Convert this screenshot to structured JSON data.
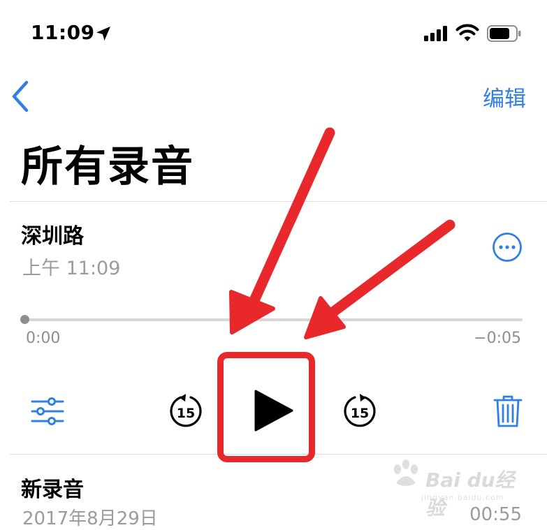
{
  "status_bar": {
    "time": "11:09",
    "icons": [
      "location-arrow-icon",
      "cellular-signal-icon",
      "wifi-icon",
      "battery-icon"
    ]
  },
  "nav": {
    "back_icon": "chevron-left-icon",
    "edit_label": "编辑"
  },
  "page_title": "所有录音",
  "recordings": [
    {
      "title": "深圳路",
      "time": "上午 11:09",
      "elapsed": "0:00",
      "remaining": "−0:05",
      "progress": 0,
      "more_icon": "ellipsis-circle-icon"
    },
    {
      "title": "新录音",
      "date": "2017年8月29日",
      "duration": "00:55"
    }
  ],
  "controls": {
    "settings_icon": "sliders-icon",
    "skip_back": "15",
    "play_icon": "play-icon",
    "skip_forward": "15",
    "delete_icon": "trash-icon"
  },
  "annotation": {
    "color": "#e8282b",
    "arrow_count": 2
  },
  "watermark": {
    "brand": "Bai du经验",
    "url": "jingyan.baidu.com"
  },
  "colors": {
    "accent": "#2f7fe6",
    "secondary_text": "#9b9b9f",
    "annotation_red": "#e8282b"
  }
}
